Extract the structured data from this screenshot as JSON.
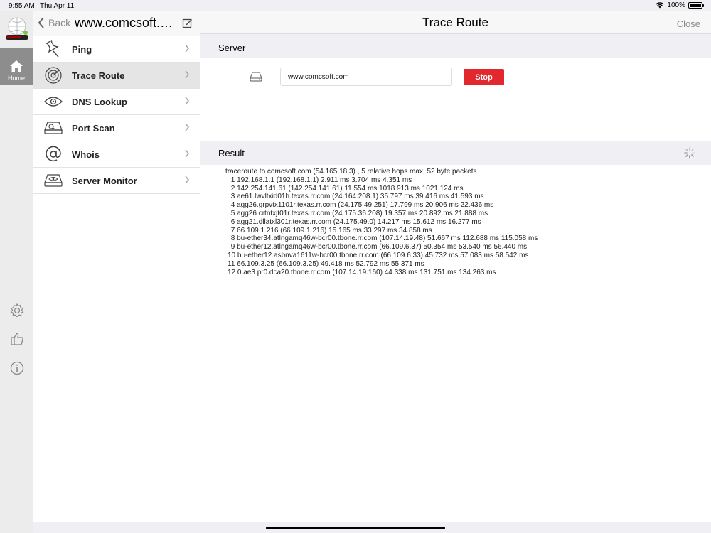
{
  "status": {
    "time": "9:55 AM",
    "date": "Thu Apr 11",
    "battery": "100%"
  },
  "rail": {
    "home_label": "Home"
  },
  "sidebar": {
    "back_label": "Back",
    "site_title": "www.comcsoft.c...",
    "items": [
      {
        "label": "Ping",
        "icon": "pin-icon"
      },
      {
        "label": "Trace Route",
        "icon": "radar-icon"
      },
      {
        "label": "DNS Lookup",
        "icon": "eye-icon"
      },
      {
        "label": "Port Scan",
        "icon": "drive-scan-icon"
      },
      {
        "label": "Whois",
        "icon": "at-icon"
      },
      {
        "label": "Server Monitor",
        "icon": "drive-eye-icon"
      }
    ]
  },
  "main": {
    "title": "Trace Route",
    "close_label": "Close",
    "server_section": "Server",
    "server_value": "www.comcsoft.com",
    "stop_label": "Stop",
    "result_section": "Result",
    "result_lines": [
      "traceroute to comcsoft.com (54.165.18.3) , 5 relative hops max, 52 byte packets",
      " 1 192.168.1.1 (192.168.1.1) 2.911 ms 3.704 ms 4.351 ms",
      " 2 142.254.141.61 (142.254.141.61) 11.554 ms 1018.913 ms 1021.124 ms",
      " 3 ae61.lwvltxid01h.texas.rr.com (24.164.208.1) 35.797 ms 39.416 ms 41.593 ms",
      " 4 agg26.grpvtx1101r.texas.rr.com (24.175.49.251) 17.799 ms 20.906 ms 22.436 ms",
      " 5 agg26.crtntxjt01r.texas.rr.com (24.175.36.208) 19.357 ms 20.892 ms 21.888 ms",
      " 6 agg21.dllatxl301r.texas.rr.com (24.175.49.0) 14.217 ms 15.612 ms 16.277 ms",
      " 7 66.109.1.216 (66.109.1.216) 15.165 ms 33.297 ms 34.858 ms",
      " 8 bu-ether34.atlngamq46w-bcr00.tbone.rr.com (107.14.19.48) 51.667 ms 112.688 ms 115.058 ms",
      " 9 bu-ether12.atlngamq46w-bcr00.tbone.rr.com (66.109.6.37) 50.354 ms 53.540 ms 56.440 ms",
      "10 bu-ether12.asbnva1611w-bcr00.tbone.rr.com (66.109.6.33) 45.732 ms 57.083 ms 58.542 ms",
      "11 66.109.3.25 (66.109.3.25) 49.418 ms 52.792 ms 55.371 ms",
      "12 0.ae3.pr0.dca20.tbone.rr.com (107.14.19.160) 44.338 ms 131.751 ms 134.263 ms"
    ]
  },
  "colors": {
    "accent_red": "#e0282d",
    "active_row": "#e5e5e5"
  }
}
